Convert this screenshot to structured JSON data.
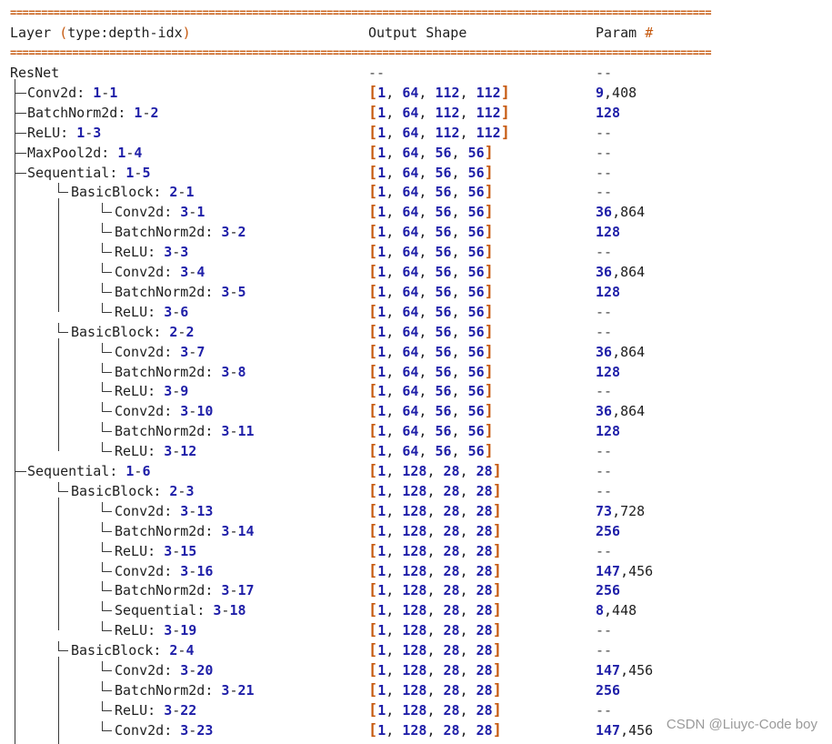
{
  "header": {
    "layer_word": "Layer",
    "layer_paren_open": "(",
    "layer_type": "type:depth-idx",
    "layer_paren_close": ")",
    "output_shape": "Output Shape",
    "param_word": "Param",
    "param_hash": "#"
  },
  "separator": "=================================================================================================================",
  "rows": [
    {
      "indent": 0,
      "label": "ResNet",
      "depth": "",
      "idx": "",
      "shape": [],
      "param": "--"
    },
    {
      "indent": 1,
      "label": "Conv2d",
      "depth": "1",
      "idx": "1",
      "shape": [
        "1",
        "64",
        "112",
        "112"
      ],
      "param": "9,408"
    },
    {
      "indent": 1,
      "label": "BatchNorm2d",
      "depth": "1",
      "idx": "2",
      "shape": [
        "1",
        "64",
        "112",
        "112"
      ],
      "param": "128"
    },
    {
      "indent": 1,
      "label": "ReLU",
      "depth": "1",
      "idx": "3",
      "shape": [
        "1",
        "64",
        "112",
        "112"
      ],
      "param": "--"
    },
    {
      "indent": 1,
      "label": "MaxPool2d",
      "depth": "1",
      "idx": "4",
      "shape": [
        "1",
        "64",
        "56",
        "56"
      ],
      "param": "--"
    },
    {
      "indent": 1,
      "label": "Sequential",
      "depth": "1",
      "idx": "5",
      "shape": [
        "1",
        "64",
        "56",
        "56"
      ],
      "param": "--"
    },
    {
      "indent": 2,
      "label": "BasicBlock",
      "depth": "2",
      "idx": "1",
      "shape": [
        "1",
        "64",
        "56",
        "56"
      ],
      "param": "--"
    },
    {
      "indent": 3,
      "label": "Conv2d",
      "depth": "3",
      "idx": "1",
      "shape": [
        "1",
        "64",
        "56",
        "56"
      ],
      "param": "36,864"
    },
    {
      "indent": 3,
      "label": "BatchNorm2d",
      "depth": "3",
      "idx": "2",
      "shape": [
        "1",
        "64",
        "56",
        "56"
      ],
      "param": "128"
    },
    {
      "indent": 3,
      "label": "ReLU",
      "depth": "3",
      "idx": "3",
      "shape": [
        "1",
        "64",
        "56",
        "56"
      ],
      "param": "--"
    },
    {
      "indent": 3,
      "label": "Conv2d",
      "depth": "3",
      "idx": "4",
      "shape": [
        "1",
        "64",
        "56",
        "56"
      ],
      "param": "36,864"
    },
    {
      "indent": 3,
      "label": "BatchNorm2d",
      "depth": "3",
      "idx": "5",
      "shape": [
        "1",
        "64",
        "56",
        "56"
      ],
      "param": "128"
    },
    {
      "indent": 3,
      "label": "ReLU",
      "depth": "3",
      "idx": "6",
      "shape": [
        "1",
        "64",
        "56",
        "56"
      ],
      "param": "--"
    },
    {
      "indent": 2,
      "label": "BasicBlock",
      "depth": "2",
      "idx": "2",
      "shape": [
        "1",
        "64",
        "56",
        "56"
      ],
      "param": "--"
    },
    {
      "indent": 3,
      "label": "Conv2d",
      "depth": "3",
      "idx": "7",
      "shape": [
        "1",
        "64",
        "56",
        "56"
      ],
      "param": "36,864"
    },
    {
      "indent": 3,
      "label": "BatchNorm2d",
      "depth": "3",
      "idx": "8",
      "shape": [
        "1",
        "64",
        "56",
        "56"
      ],
      "param": "128"
    },
    {
      "indent": 3,
      "label": "ReLU",
      "depth": "3",
      "idx": "9",
      "shape": [
        "1",
        "64",
        "56",
        "56"
      ],
      "param": "--"
    },
    {
      "indent": 3,
      "label": "Conv2d",
      "depth": "3",
      "idx": "10",
      "shape": [
        "1",
        "64",
        "56",
        "56"
      ],
      "param": "36,864"
    },
    {
      "indent": 3,
      "label": "BatchNorm2d",
      "depth": "3",
      "idx": "11",
      "shape": [
        "1",
        "64",
        "56",
        "56"
      ],
      "param": "128"
    },
    {
      "indent": 3,
      "label": "ReLU",
      "depth": "3",
      "idx": "12",
      "shape": [
        "1",
        "64",
        "56",
        "56"
      ],
      "param": "--"
    },
    {
      "indent": 1,
      "label": "Sequential",
      "depth": "1",
      "idx": "6",
      "shape": [
        "1",
        "128",
        "28",
        "28"
      ],
      "param": "--"
    },
    {
      "indent": 2,
      "label": "BasicBlock",
      "depth": "2",
      "idx": "3",
      "shape": [
        "1",
        "128",
        "28",
        "28"
      ],
      "param": "--"
    },
    {
      "indent": 3,
      "label": "Conv2d",
      "depth": "3",
      "idx": "13",
      "shape": [
        "1",
        "128",
        "28",
        "28"
      ],
      "param": "73,728"
    },
    {
      "indent": 3,
      "label": "BatchNorm2d",
      "depth": "3",
      "idx": "14",
      "shape": [
        "1",
        "128",
        "28",
        "28"
      ],
      "param": "256"
    },
    {
      "indent": 3,
      "label": "ReLU",
      "depth": "3",
      "idx": "15",
      "shape": [
        "1",
        "128",
        "28",
        "28"
      ],
      "param": "--"
    },
    {
      "indent": 3,
      "label": "Conv2d",
      "depth": "3",
      "idx": "16",
      "shape": [
        "1",
        "128",
        "28",
        "28"
      ],
      "param": "147,456"
    },
    {
      "indent": 3,
      "label": "BatchNorm2d",
      "depth": "3",
      "idx": "17",
      "shape": [
        "1",
        "128",
        "28",
        "28"
      ],
      "param": "256"
    },
    {
      "indent": 3,
      "label": "Sequential",
      "depth": "3",
      "idx": "18",
      "shape": [
        "1",
        "128",
        "28",
        "28"
      ],
      "param": "8,448"
    },
    {
      "indent": 3,
      "label": "ReLU",
      "depth": "3",
      "idx": "19",
      "shape": [
        "1",
        "128",
        "28",
        "28"
      ],
      "param": "--"
    },
    {
      "indent": 2,
      "label": "BasicBlock",
      "depth": "2",
      "idx": "4",
      "shape": [
        "1",
        "128",
        "28",
        "28"
      ],
      "param": "--"
    },
    {
      "indent": 3,
      "label": "Conv2d",
      "depth": "3",
      "idx": "20",
      "shape": [
        "1",
        "128",
        "28",
        "28"
      ],
      "param": "147,456"
    },
    {
      "indent": 3,
      "label": "BatchNorm2d",
      "depth": "3",
      "idx": "21",
      "shape": [
        "1",
        "128",
        "28",
        "28"
      ],
      "param": "256"
    },
    {
      "indent": 3,
      "label": "ReLU",
      "depth": "3",
      "idx": "22",
      "shape": [
        "1",
        "128",
        "28",
        "28"
      ],
      "param": "--"
    },
    {
      "indent": 3,
      "label": "Conv2d",
      "depth": "3",
      "idx": "23",
      "shape": [
        "1",
        "128",
        "28",
        "28"
      ],
      "param": "147,456"
    }
  ],
  "watermark": "CSDN @Liuyc-Code boy",
  "colors": {
    "number": "#1f1fa8",
    "bracket": "#c65a10",
    "separator": "#c65a10",
    "text": "#1f1f1f"
  }
}
